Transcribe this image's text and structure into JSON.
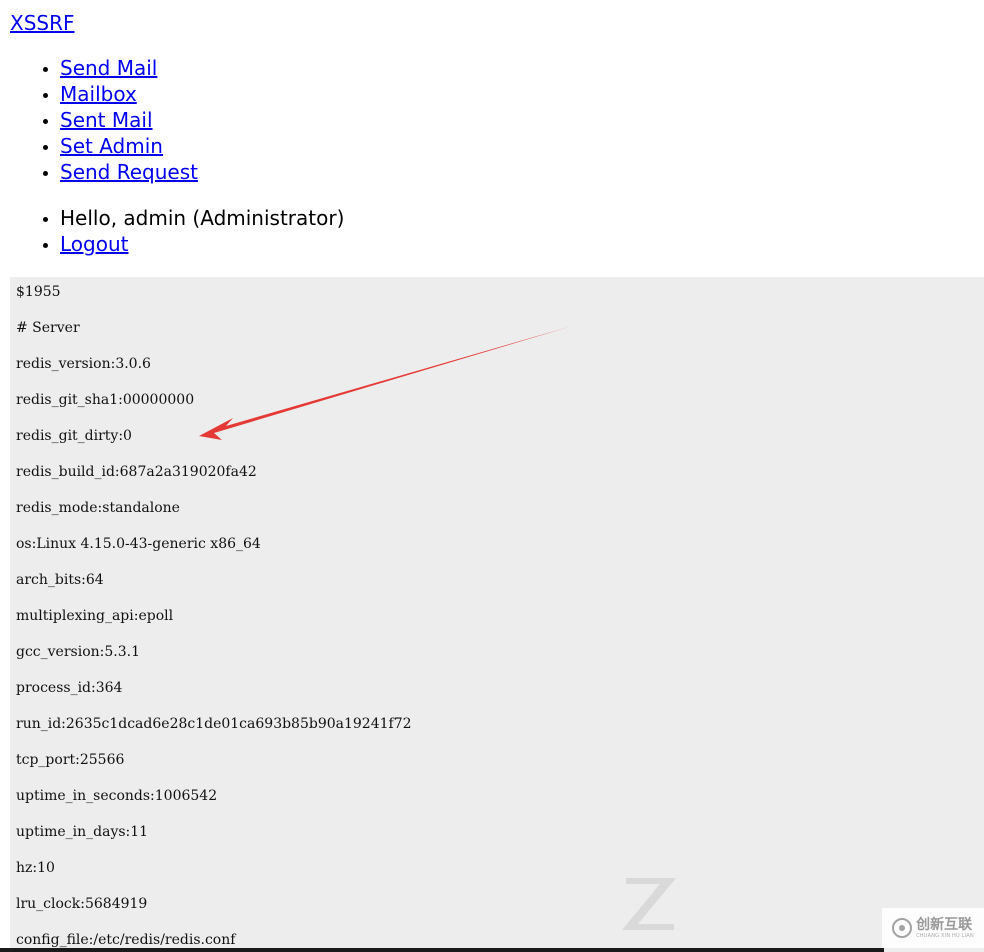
{
  "header": {
    "brand": "XSSRF"
  },
  "nav": {
    "items": [
      {
        "label": "Send Mail"
      },
      {
        "label": "Mailbox"
      },
      {
        "label": "Sent Mail"
      },
      {
        "label": "Set Admin"
      },
      {
        "label": "Send Request"
      }
    ]
  },
  "user": {
    "greeting": "Hello, admin (Administrator)",
    "logout_label": "Logout"
  },
  "response": {
    "lines": [
      "$1955",
      "# Server",
      "redis_version:3.0.6",
      "redis_git_sha1:00000000",
      "redis_git_dirty:0",
      "redis_build_id:687a2a319020fa42",
      "redis_mode:standalone",
      "os:Linux 4.15.0-43-generic x86_64",
      "arch_bits:64",
      "multiplexing_api:epoll",
      "gcc_version:5.3.1",
      "process_id:364",
      "run_id:2635c1dcad6e28c1de01ca693b85b90a19241f72",
      "tcp_port:25566",
      "uptime_in_seconds:1006542",
      "uptime_in_days:11",
      "hz:10",
      "lru_clock:5684919",
      "config_file:/etc/redis/redis.conf"
    ]
  },
  "annotation": {
    "arrow_color": "#e53935"
  },
  "watermark": {
    "cn": "创新互联",
    "en": "CHUANG XIN HU LIAN"
  },
  "colors": {
    "link": "#0000ee",
    "panel_bg": "#ededed"
  }
}
